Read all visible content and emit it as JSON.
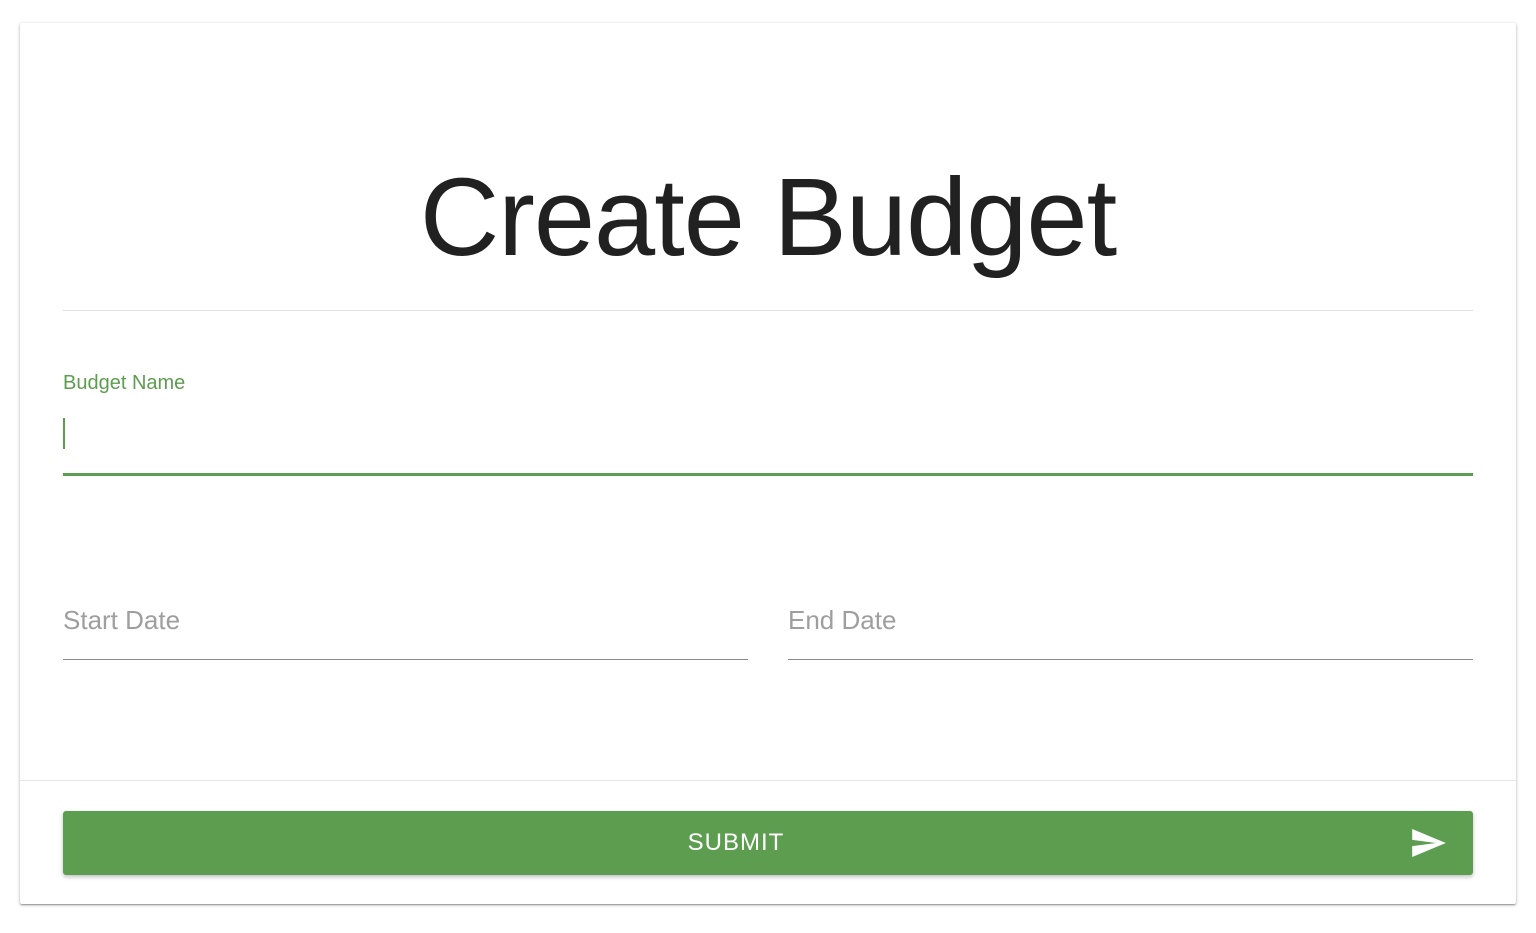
{
  "form": {
    "title": "Create Budget",
    "budget_name": {
      "label": "Budget Name",
      "value": ""
    },
    "start_date": {
      "placeholder": "Start Date"
    },
    "end_date": {
      "placeholder": "End Date"
    },
    "submit": {
      "label": "SUBMIT",
      "icon": "send-icon"
    }
  },
  "colors": {
    "accent": "#5d9d50",
    "title_text": "#212121",
    "placeholder_text": "#9e9e9e",
    "button_text": "#ffffff"
  }
}
